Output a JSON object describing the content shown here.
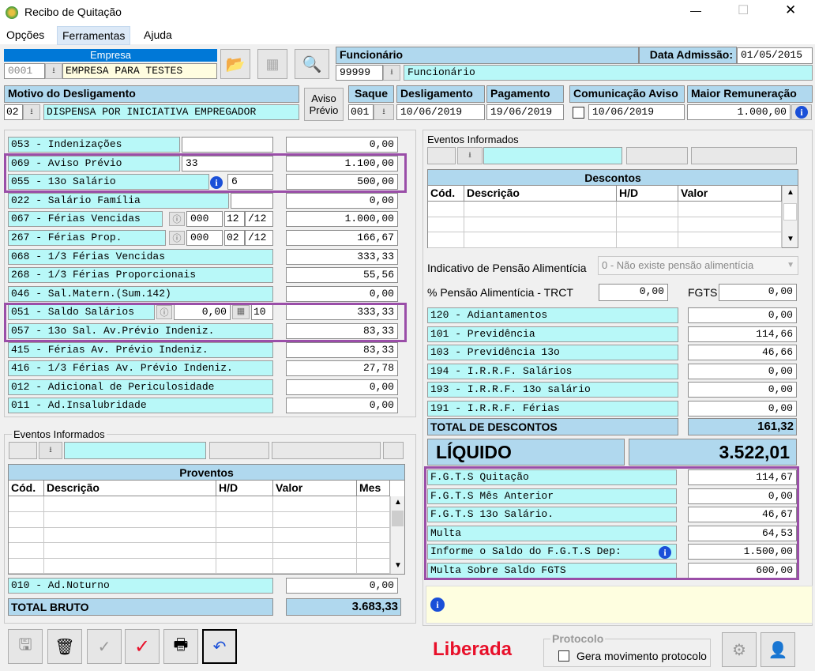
{
  "window": {
    "title": "Recibo de Quitação",
    "minimize": "—",
    "maximize": "☐",
    "close": "✕"
  },
  "menu": [
    "Opções",
    "Ferramentas",
    "Ajuda"
  ],
  "empresa": {
    "label": "Empresa",
    "code": "0001",
    "name": "EMPRESA PARA TESTES"
  },
  "funcionario": {
    "label": "Funcionário",
    "code": "99999",
    "name": "Funcionário"
  },
  "admissao": {
    "label": "Data Admissão:",
    "value": "01/05/2015"
  },
  "motivo": {
    "label": "Motivo do Desligamento",
    "code": "02",
    "name": "DISPENSA POR INICIATIVA EMPREGADOR"
  },
  "aviso_button": "Aviso Prévio",
  "saque": {
    "label": "Saque",
    "value": "001"
  },
  "desligamento": {
    "label": "Desligamento",
    "value": "10/06/2019"
  },
  "pagamento": {
    "label": "Pagamento",
    "value": "19/06/2019"
  },
  "comunicacao": {
    "label": "Comunicação Aviso",
    "value": "10/06/2019"
  },
  "maior": {
    "label": "Maior Remuneração",
    "value": "1.000,00"
  },
  "proventos_list": [
    {
      "desc": "053 - Indenizações",
      "value": "0,00"
    },
    {
      "desc": "069 - Aviso Prévio",
      "a": "33",
      "value": "1.100,00"
    },
    {
      "desc": "055 - 13o Salário",
      "a": "6",
      "value": "500,00"
    },
    {
      "desc": "022 - Salário Família",
      "value": "0,00"
    },
    {
      "desc": "067 - Férias Vencidas",
      "a": "000",
      "b": "12",
      "c": "/12",
      "value": "1.000,00"
    },
    {
      "desc": "267 - Férias Prop.",
      "a": "000",
      "b": "02",
      "c": "/12",
      "value": "166,67"
    },
    {
      "desc": "068 - 1/3 Férias Vencidas",
      "value": "333,33"
    },
    {
      "desc": "268 - 1/3 Férias Proporcionais",
      "value": "55,56"
    },
    {
      "desc": "046 - Sal.Matern.(Sum.142)",
      "value": "0,00"
    },
    {
      "desc": "051 - Saldo Salários",
      "a": "0,00",
      "b": "10",
      "value": "333,33"
    },
    {
      "desc": "057 - 13o Sal. Av.Prévio Indeniz.",
      "value": "83,33"
    },
    {
      "desc": "415  - Férias  Av. Prévio Indeniz.",
      "value": "83,33"
    },
    {
      "desc": "416  - 1/3 Férias Av. Prévio Indeniz.",
      "value": "27,78"
    },
    {
      "desc": "012 - Adicional de Periculosidade",
      "value": "0,00"
    },
    {
      "desc": "011 - Ad.Insalubridade",
      "value": "0,00"
    }
  ],
  "eventos_left": {
    "label": "Eventos Informados",
    "grid_title": "Proventos",
    "cols": [
      "Cód.",
      "Descrição",
      "H/D",
      "Valor",
      "Mes"
    ]
  },
  "noturno": {
    "desc": "010 - Ad.Noturno",
    "value": "0,00"
  },
  "total_bruto": {
    "label": "TOTAL BRUTO",
    "value": "3.683,33"
  },
  "eventos_right": {
    "label": "Eventos Informados",
    "grid_title": "Descontos",
    "cols": [
      "Cód.",
      "Descrição",
      "H/D",
      "Valor"
    ]
  },
  "pensao": {
    "label": "Indicativo de Pensão Alimentícia",
    "value": "0 - Não existe pensão alimentícia"
  },
  "pct_pensao": {
    "label": "% Pensão Alimentícia - TRCT",
    "value": "0,00"
  },
  "fgts_box": {
    "label": "FGTS",
    "value": "0,00"
  },
  "descontos_list": [
    {
      "desc": "120 - Adiantamentos",
      "value": "0,00"
    },
    {
      "desc": "101 - Previdência",
      "value": "114,66"
    },
    {
      "desc": "103 - Previdência 13o",
      "value": "46,66"
    },
    {
      "desc": "194 - I.R.R.F. Salários",
      "value": "0,00"
    },
    {
      "desc": "193 - I.R.R.F. 13o salário",
      "value": "0,00"
    },
    {
      "desc": "191 - I.R.R.F. Férias",
      "value": "0,00"
    }
  ],
  "total_descontos": {
    "label": "TOTAL DE DESCONTOS",
    "value": "161,32"
  },
  "liquido": {
    "label": "LÍQUIDO",
    "value": "3.522,01"
  },
  "fgts_list": [
    {
      "desc": "F.G.T.S  Quitação",
      "value": "114,67"
    },
    {
      "desc": "F.G.T.S  Mês Anterior",
      "value": "0,00"
    },
    {
      "desc": "F.G.T.S  13o Salário.",
      "value": "46,67"
    },
    {
      "desc": "Multa",
      "value": "64,53"
    },
    {
      "desc": "Informe o Saldo do F.G.T.S Dep:",
      "value": "1.500,00"
    },
    {
      "desc": "Multa Sobre Saldo FGTS",
      "value": "600,00"
    }
  ],
  "status": "Liberada",
  "protocolo": {
    "label": "Protocolo",
    "checkbox": "Gera movimento protocolo"
  },
  "colors": {
    "accent": "#0078d7",
    "cyan": "#b8f8f8",
    "highlight": "#9a4ea8",
    "status": "#e8102a"
  }
}
